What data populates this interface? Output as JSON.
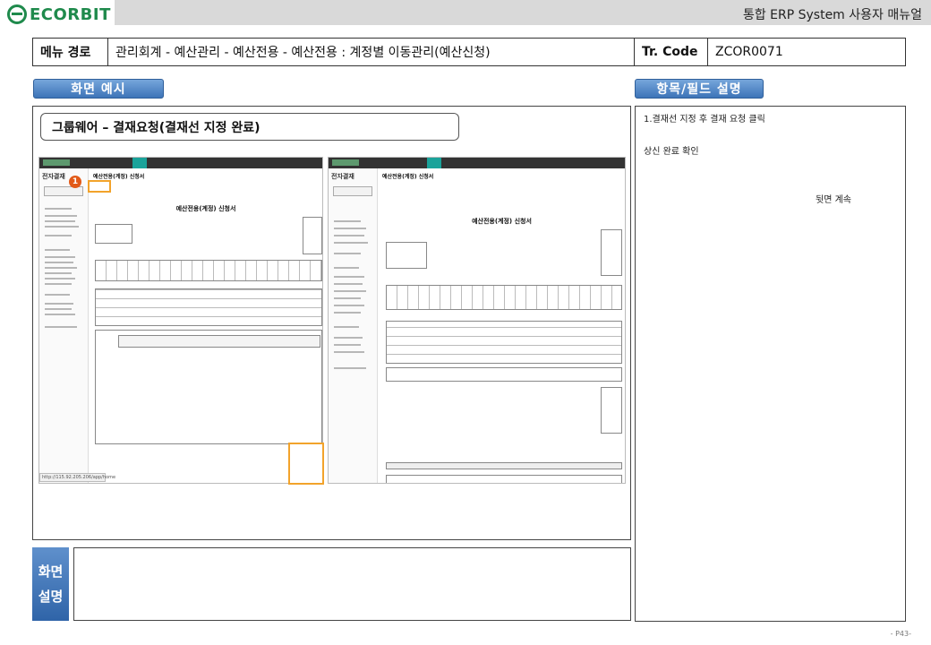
{
  "header": {
    "logo_text": "ECORBIT",
    "manual_title": "통합 ERP System 사용자 매뉴얼"
  },
  "path_bar": {
    "menu_path_label": "메뉴 경로",
    "menu_path_value": "관리회계 - 예산관리 - 예산전용 - 예산전용 : 계정별 이동관리(예산신청)",
    "tr_code_label": "Tr. Code",
    "tr_code_value": "ZCOR0071"
  },
  "sections": {
    "screen_example": "화면 예시",
    "field_description": "항목/필드 설명"
  },
  "screen": {
    "caption": "그룹웨어 – 결재요청(결재선 지정 완료)",
    "left_shot": {
      "sidebar_title": "전자결재",
      "doc_header": "예산전용(계정) 신청서",
      "doc_title": "예산전용(계정) 신청서",
      "step_badge": "1",
      "url": "http://115.92.205.206/app/home"
    },
    "right_shot": {
      "sidebar_title": "전자결재",
      "doc_header": "예산전용(계정) 신청서",
      "doc_title": "예산전용(계정) 신청서"
    }
  },
  "description": {
    "lines": [
      "1.결재선 지정 후 결재 요청 클릭",
      "상신 완료 확인",
      "뒷면 계속"
    ]
  },
  "explain": {
    "tag": "화면 설명",
    "tag_line1": "화면",
    "tag_line2": "설명",
    "text": ""
  },
  "footer": {
    "page_number": "- P43-"
  },
  "colors": {
    "brand_green": "#1f8a4c",
    "pill_blue": "#3d74b8",
    "highlight_orange": "#f2a32b",
    "badge_orange": "#e25a18"
  }
}
